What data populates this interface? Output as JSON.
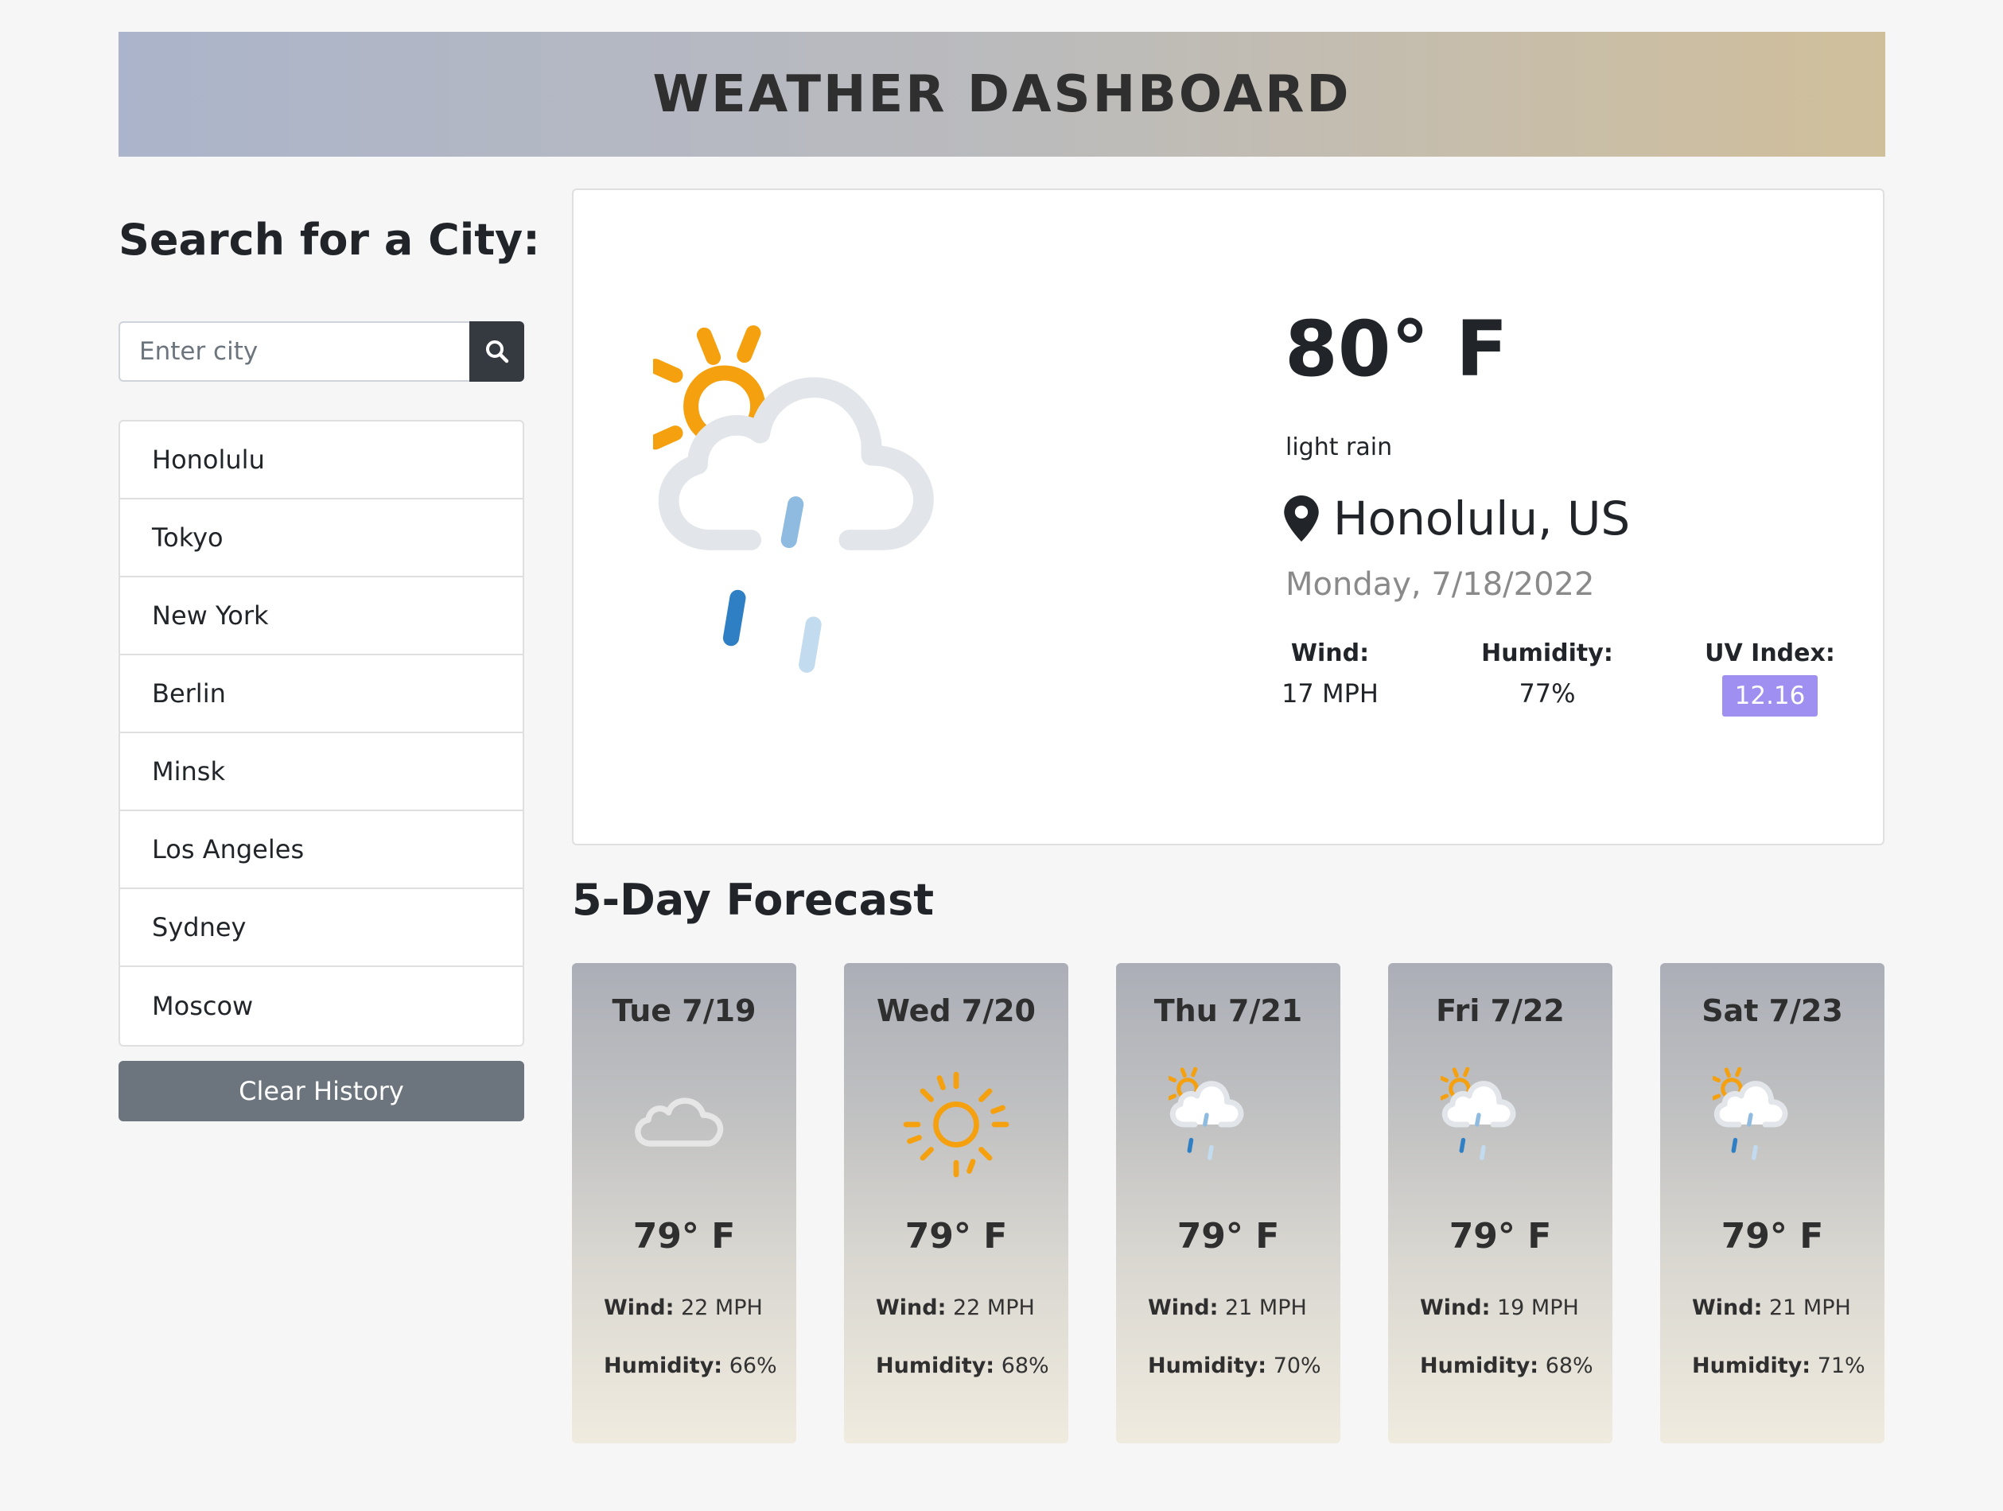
{
  "header": {
    "title": "WEATHER DASHBOARD"
  },
  "search": {
    "title": "Search for a City:",
    "placeholder": "Enter city",
    "value": ""
  },
  "history": {
    "items": [
      "Honolulu",
      "Tokyo",
      "New York",
      "Berlin",
      "Minsk",
      "Los Angeles",
      "Sydney",
      "Moscow"
    ],
    "clear_label": "Clear History"
  },
  "current": {
    "temp": "80° F",
    "description": "light rain",
    "location": "Honolulu, US",
    "date": "Monday, 7/18/2022",
    "icon": "sun-cloud-rain-icon",
    "wind_label": "Wind:",
    "wind_value": "17 MPH",
    "humidity_label": "Humidity:",
    "humidity_value": "77%",
    "uv_label": "UV Index:",
    "uv_value": "12.16",
    "uv_color": "#9f8ff0"
  },
  "forecast": {
    "title": "5-Day Forecast",
    "wind_label": "Wind:",
    "humidity_label": "Humidity:",
    "days": [
      {
        "date": "Tue 7/19",
        "temp": "79° F",
        "wind": "22 MPH",
        "humidity": "66%",
        "icon": "cloud-icon"
      },
      {
        "date": "Wed 7/20",
        "temp": "79° F",
        "wind": "22 MPH",
        "humidity": "68%",
        "icon": "sun-icon"
      },
      {
        "date": "Thu 7/21",
        "temp": "79° F",
        "wind": "21 MPH",
        "humidity": "70%",
        "icon": "sun-cloud-rain-icon"
      },
      {
        "date": "Fri 7/22",
        "temp": "79° F",
        "wind": "19 MPH",
        "humidity": "68%",
        "icon": "sun-cloud-rain-icon"
      },
      {
        "date": "Sat 7/23",
        "temp": "79° F",
        "wind": "21 MPH",
        "humidity": "71%",
        "icon": "sun-cloud-rain-icon"
      }
    ]
  },
  "colors": {
    "sun": "#f5a00f",
    "cloud": "#e2e5e9",
    "rain_dark": "#2e7fc4",
    "rain_mid": "#8fbbe0",
    "rain_light": "#c2dbef"
  }
}
